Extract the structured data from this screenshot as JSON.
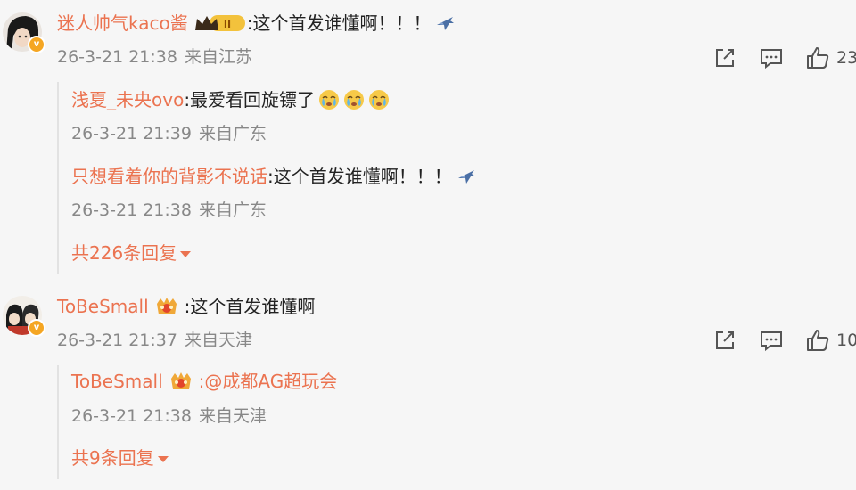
{
  "comments": [
    {
      "user": "迷人帅气kaco酱",
      "badge_text": "II",
      "content": ":这个首发谁懂啊！！！",
      "time": "26-3-21 21:38",
      "location": "来自江苏",
      "likes": "23",
      "replies": [
        {
          "user": "浅夏_未央ovo",
          "content": ":最爱看回旋镖了",
          "time": "26-3-21 21:39",
          "location": "来自广东"
        },
        {
          "user": "只想看着你的背影不说话",
          "content": ":这个首发谁懂啊！！！",
          "time": "26-3-21 21:38",
          "location": "来自广东"
        }
      ],
      "more_replies": "共226条回复"
    },
    {
      "user": "ToBeSmall",
      "content": ":这个首发谁懂啊",
      "time": "26-3-21 21:37",
      "location": "来自天津",
      "likes": "10",
      "replies": [
        {
          "user": "ToBeSmall",
          "content": ":@成都AG超玩会",
          "time": "26-3-21 21:38",
          "location": "来自天津"
        }
      ],
      "more_replies": "共9条回复"
    }
  ],
  "colors": {
    "username": "#eb7350",
    "meta": "#888888",
    "background": "#f6f6f6"
  },
  "icons": [
    "share-icon",
    "comment-icon",
    "like-icon",
    "airplane-emoji",
    "crying-emoji",
    "crown-badge",
    "vip-badge"
  ]
}
